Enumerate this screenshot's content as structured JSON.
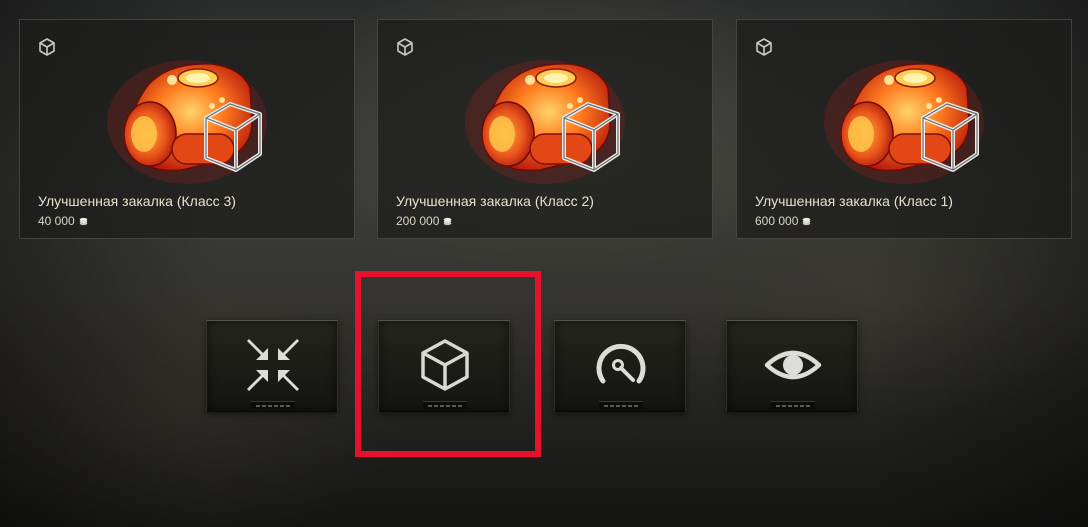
{
  "cards": [
    {
      "title": "Улучшенная закалка (Класс 3)",
      "price": "40 000",
      "icon": "cube-outline-icon",
      "image": "improved-hardening-equipment-image"
    },
    {
      "title": "Улучшенная закалка (Класс 2)",
      "price": "200 000",
      "icon": "cube-outline-icon",
      "image": "improved-hardening-equipment-image"
    },
    {
      "title": "Улучшенная закалка (Класс 1)",
      "price": "600 000",
      "icon": "cube-outline-icon",
      "image": "improved-hardening-equipment-image"
    }
  ],
  "currency_icon": "credits-icon",
  "filters": [
    {
      "icon": "arrows-inward-icon",
      "selected": false
    },
    {
      "icon": "cube-outline-icon",
      "selected": true
    },
    {
      "icon": "gauge-icon",
      "selected": false
    },
    {
      "icon": "eye-icon",
      "selected": false
    }
  ],
  "colors": {
    "highlight": "#e8112d",
    "title_text": "#e9e2cc",
    "icon_light": "#d8d8d4"
  }
}
